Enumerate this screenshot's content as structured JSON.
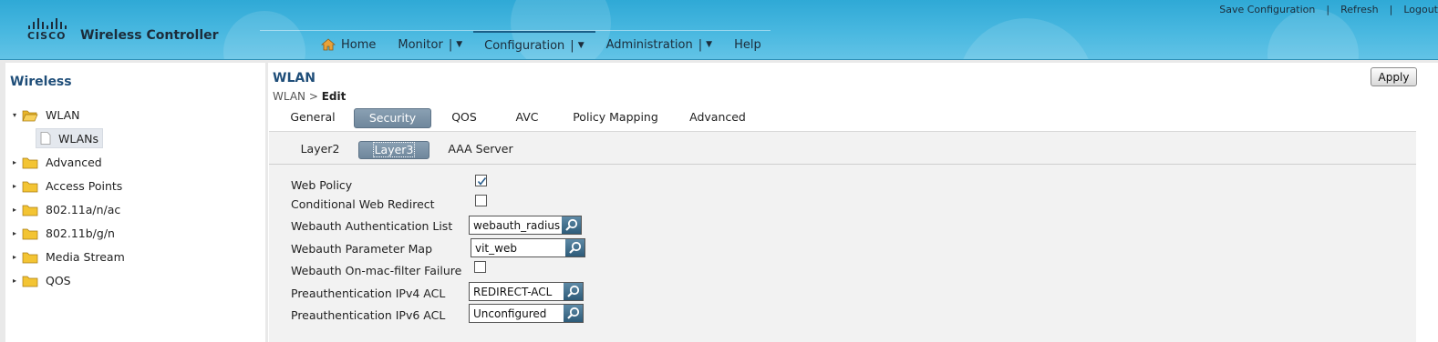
{
  "header": {
    "logo_text": "CISCO",
    "product": "Wireless Controller",
    "top_links": [
      "Save Configuration",
      "Refresh",
      "Logout"
    ],
    "top_sep": "|",
    "nav": [
      {
        "label": "Home"
      },
      {
        "label": "Monitor"
      },
      {
        "label": "Configuration"
      },
      {
        "label": "Administration"
      },
      {
        "label": "Help"
      }
    ],
    "nav_pipe": "|",
    "caret": "▼"
  },
  "sidebar": {
    "title": "Wireless",
    "items": [
      {
        "label": "WLAN",
        "expanded": true
      },
      {
        "label": "WLANs",
        "selected": true
      },
      {
        "label": "Advanced"
      },
      {
        "label": "Access Points"
      },
      {
        "label": "802.11a/n/ac"
      },
      {
        "label": "802.11b/g/n"
      },
      {
        "label": "Media Stream"
      },
      {
        "label": "QOS"
      }
    ],
    "expanded_glyph": "▾",
    "collapsed_glyph": "▸"
  },
  "main": {
    "title": "WLAN",
    "breadcrumb_parent": "WLAN >",
    "breadcrumb_current": "Edit",
    "apply_label": "Apply",
    "tabs": [
      "General",
      "Security",
      "QOS",
      "AVC",
      "Policy Mapping",
      "Advanced"
    ],
    "active_tab": "Security",
    "subtabs": [
      "Layer2",
      "Layer3",
      "AAA Server"
    ],
    "active_subtab": "Layer3",
    "form": {
      "web_policy": {
        "label": "Web Policy",
        "checked": true
      },
      "conditional_redirect": {
        "label": "Conditional Web Redirect",
        "checked": false
      },
      "auth_list": {
        "label": "Webauth Authentication List",
        "value": "webauth_radius"
      },
      "param_map": {
        "label": "Webauth Parameter Map",
        "value": "vit_web"
      },
      "on_mac_failure": {
        "label": "Webauth On-mac-filter Failure",
        "checked": false
      },
      "ipv4_acl": {
        "label": "Preauthentication IPv4 ACL",
        "value": "REDIRECT-ACL"
      },
      "ipv6_acl": {
        "label": "Preauthentication IPv6 ACL",
        "value": "Unconfigured"
      }
    }
  },
  "colors": {
    "header_blue": "#49b8e0",
    "title_blue": "#1f4e79",
    "active_tab": "#7a90a5",
    "folder_yellow": "#f3c433"
  },
  "icons": [
    "home-icon",
    "folder-icon",
    "document-icon",
    "search-icon",
    "checkmark-icon",
    "expand-arrow-icon",
    "collapse-arrow-icon"
  ]
}
